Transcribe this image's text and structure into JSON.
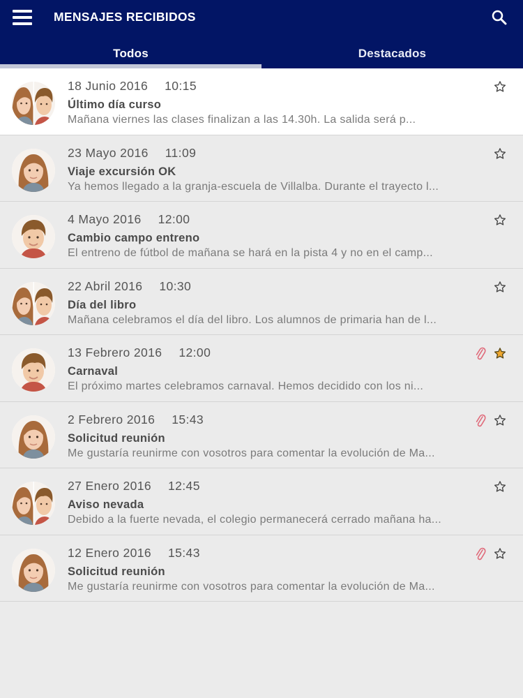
{
  "header": {
    "title": "MENSAJES RECIBIDOS",
    "menu_icon": "hamburger-menu-icon",
    "search_icon": "search-icon"
  },
  "tabs": [
    {
      "label": "Todos",
      "selected": true
    },
    {
      "label": "Destacados",
      "selected": false
    }
  ],
  "colors": {
    "appbar": "#021565",
    "star_filled": "#f0a830",
    "attachment": "#e06a7a"
  },
  "messages": [
    {
      "date": "18 Junio 2016",
      "time": "10:15",
      "subject": "Último día curso",
      "preview": "Mañana viernes las clases finalizan a las 14.30h. La salida será p...",
      "avatar": "two-children",
      "attachment": false,
      "starred": false,
      "unread": true
    },
    {
      "date": "23 Mayo 2016",
      "time": "11:09",
      "subject": "Viaje excursión OK",
      "preview": "Ya hemos llegado a la granja-escuela de Villalba. Durante el trayecto l...",
      "avatar": "girl",
      "attachment": false,
      "starred": false,
      "unread": false
    },
    {
      "date": "4 Mayo 2016",
      "time": "12:00",
      "subject": "Cambio campo entreno",
      "preview": "El entreno de fútbol de mañana se hará en la pista 4 y no en el camp...",
      "avatar": "boy",
      "attachment": false,
      "starred": false,
      "unread": false
    },
    {
      "date": "22 Abril 2016",
      "time": "10:30",
      "subject": "Día del libro",
      "preview": "Mañana celebramos el día del libro. Los alumnos de primaria han de l...",
      "avatar": "two-children",
      "attachment": false,
      "starred": false,
      "unread": false
    },
    {
      "date": "13 Febrero 2016",
      "time": "12:00",
      "subject": "Carnaval",
      "preview": "El próximo martes celebramos carnaval. Hemos decidido con los ni...",
      "avatar": "boy",
      "attachment": true,
      "starred": true,
      "unread": false
    },
    {
      "date": "2 Febrero 2016",
      "time": "15:43",
      "subject": "Solicitud reunión",
      "preview": "Me gustaría reunirme con vosotros para comentar la evolución de Ma...",
      "avatar": "girl",
      "attachment": true,
      "starred": false,
      "unread": false
    },
    {
      "date": "27 Enero 2016",
      "time": "12:45",
      "subject": "Aviso nevada",
      "preview": "Debido a la fuerte nevada, el colegio permanecerá cerrado mañana ha...",
      "avatar": "two-children",
      "attachment": false,
      "starred": false,
      "unread": false
    },
    {
      "date": "12 Enero 2016",
      "time": "15:43",
      "subject": "Solicitud reunión",
      "preview": "Me gustaría reunirme con vosotros para comentar la evolución de Ma...",
      "avatar": "girl",
      "attachment": true,
      "starred": false,
      "unread": false
    }
  ]
}
